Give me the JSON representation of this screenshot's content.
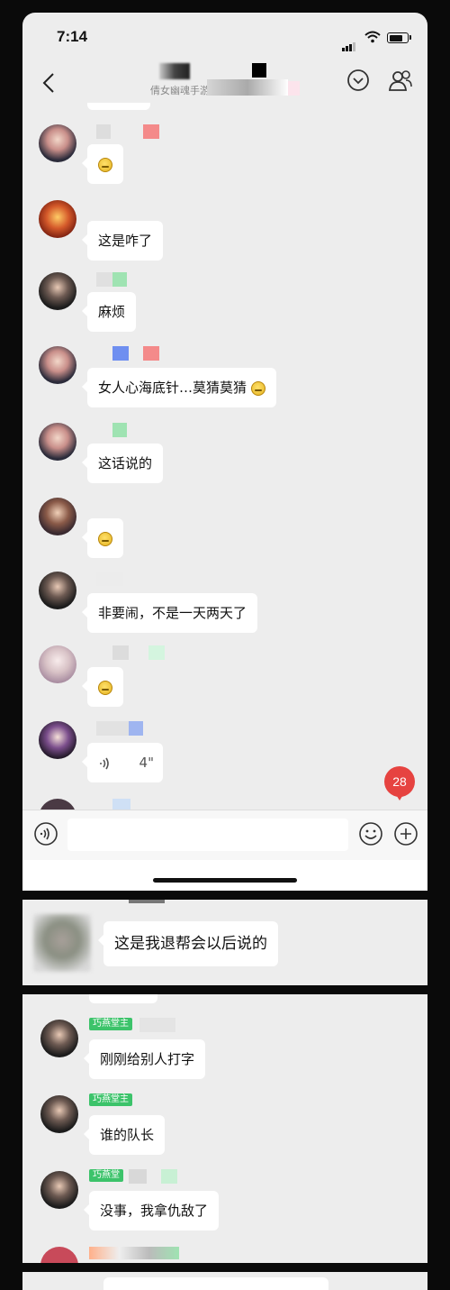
{
  "status_bar": {
    "time": "7:14"
  },
  "header": {
    "title": "倩女幽魂手游"
  },
  "messages": [
    {
      "text": ""
    },
    {
      "text": "这是咋了"
    },
    {
      "text": "麻烦"
    },
    {
      "text": "女人心海底针…莫猜莫猜"
    },
    {
      "text": "这话说的"
    },
    {
      "text": ""
    },
    {
      "text": "非要闹，不是一天两天了"
    },
    {
      "text": ""
    },
    {
      "text": "4\""
    }
  ],
  "unread_count": "28",
  "crop2": {
    "text": "这是我退帮会以后说的"
  },
  "crop3": {
    "messages": [
      {
        "tag": "巧燕堂主",
        "text": "刚刚给别人打字"
      },
      {
        "tag": "巧燕堂主",
        "text": "谁的队长"
      },
      {
        "tag": "巧燕堂",
        "text": "没事，我拿仇敌了"
      }
    ]
  },
  "icons": [
    "back-icon",
    "chevron-down-circle-icon",
    "group-members-icon",
    "voice-input-icon",
    "emoji-icon",
    "plus-icon",
    "signal-icon",
    "wifi-icon",
    "battery-icon"
  ],
  "colors": {
    "chat_bg": "#ededed",
    "bubble": "#ffffff",
    "badge": "#e64340",
    "tag": "#3cc36a"
  }
}
